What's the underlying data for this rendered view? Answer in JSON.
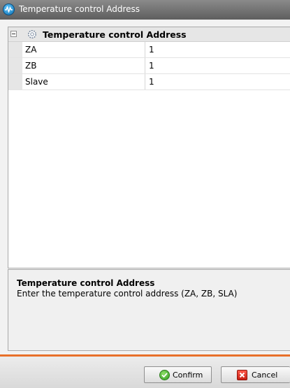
{
  "window": {
    "title": "Temperature control Address"
  },
  "grid": {
    "category": "Temperature control Address",
    "properties": [
      {
        "name": "ZA",
        "value": "1"
      },
      {
        "name": "ZB",
        "value": "1"
      },
      {
        "name": "Slave",
        "value": "1"
      }
    ]
  },
  "description": {
    "title": "Temperature control Address",
    "text": "Enter the temperature control address (ZA, ZB, SLA)"
  },
  "footer": {
    "confirm_label": "Confirm",
    "cancel_label": "Cancel",
    "accent_color": "#e8702a"
  }
}
